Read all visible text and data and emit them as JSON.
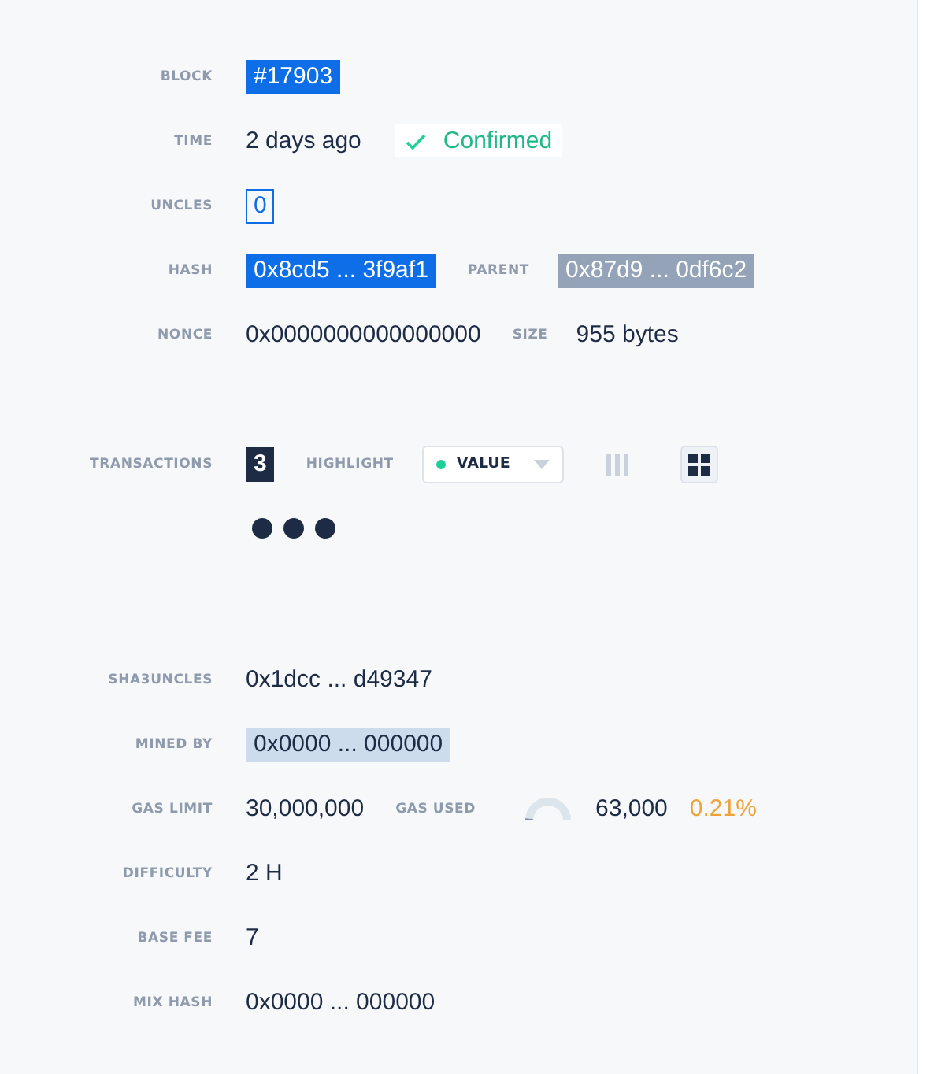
{
  "sections": [
    {
      "rows": [
        {
          "label": "BLOCK",
          "items": [
            {
              "kind": "primary-tag",
              "text": "#17903"
            }
          ]
        },
        {
          "label": "TIME",
          "items": [
            {
              "kind": "plain",
              "text": "2 days ago"
            },
            {
              "kind": "status",
              "text": "Confirmed"
            }
          ]
        },
        {
          "label": "UNCLES",
          "items": [
            {
              "kind": "outline-tag",
              "text": "0"
            }
          ]
        },
        {
          "label": "HASH",
          "items": [
            {
              "kind": "primary-tag",
              "text": "0x8cd5 ... 3f9af1"
            },
            {
              "kind": "label",
              "text": "PARENT"
            },
            {
              "kind": "muted-tag",
              "text": "0x87d9 ... 0df6c2"
            }
          ]
        },
        {
          "label": "NONCE",
          "items": [
            {
              "kind": "plain",
              "text": "0x0000000000000000"
            },
            {
              "kind": "label",
              "text": "SIZE"
            },
            {
              "kind": "plain",
              "text": "955 bytes"
            }
          ]
        }
      ]
    },
    {
      "rows": [
        {
          "label": "TRANSACTIONS",
          "items": [
            {
              "kind": "dark-tag",
              "text": "3"
            },
            {
              "kind": "label",
              "text": "HIGHLIGHT"
            },
            {
              "kind": "dropdown",
              "text": "VALUE",
              "color": "#1fcf9a"
            },
            {
              "kind": "columns-toggle",
              "selected": false
            },
            {
              "kind": "grid-toggle",
              "selected": true
            }
          ]
        },
        {
          "label": "",
          "items": [
            {
              "kind": "dot"
            },
            {
              "kind": "dot"
            },
            {
              "kind": "dot"
            }
          ]
        }
      ]
    },
    {
      "rows": [
        {
          "label": "SHA3UNCLES",
          "items": [
            {
              "kind": "plain",
              "text": "0x1dcc ... d49347"
            }
          ]
        },
        {
          "label": "MINED BY",
          "items": [
            {
              "kind": "highlight-tag",
              "text": "0x0000 ... 000000"
            }
          ]
        },
        {
          "label": "GAS LIMIT",
          "items": [
            {
              "kind": "plain",
              "text": "30,000,000"
            },
            {
              "kind": "label",
              "text": "GAS USED"
            },
            {
              "kind": "gauge"
            },
            {
              "kind": "plain",
              "text": "63,000"
            },
            {
              "kind": "percent",
              "text": "0.21%"
            }
          ]
        },
        {
          "label": "DIFFICULTY",
          "items": [
            {
              "kind": "plain",
              "text": "2 H"
            }
          ]
        },
        {
          "label": "BASE FEE",
          "items": [
            {
              "kind": "plain",
              "text": "7"
            }
          ]
        },
        {
          "label": "MIX HASH",
          "items": [
            {
              "kind": "plain",
              "text": "0x0000 ... 000000"
            }
          ]
        }
      ]
    }
  ]
}
